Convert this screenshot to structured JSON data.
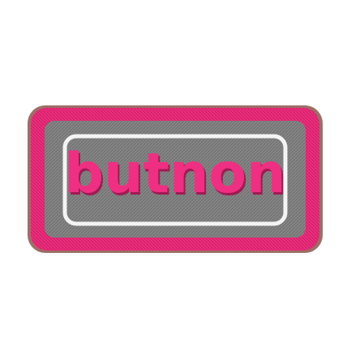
{
  "patch": {
    "text": "butnon",
    "colors": {
      "background": "#ffffff",
      "border_pink": "#ee2d7e",
      "border_pink_dark": "#c81f63",
      "rim_brown": "#9c6f66",
      "fill_gray": "#858585",
      "fill_gray_dark": "#6f6f6f",
      "inner_line_white": "#f4f4f4",
      "text_pink": "#ef2f82",
      "text_shadow": "#a11a54"
    }
  }
}
